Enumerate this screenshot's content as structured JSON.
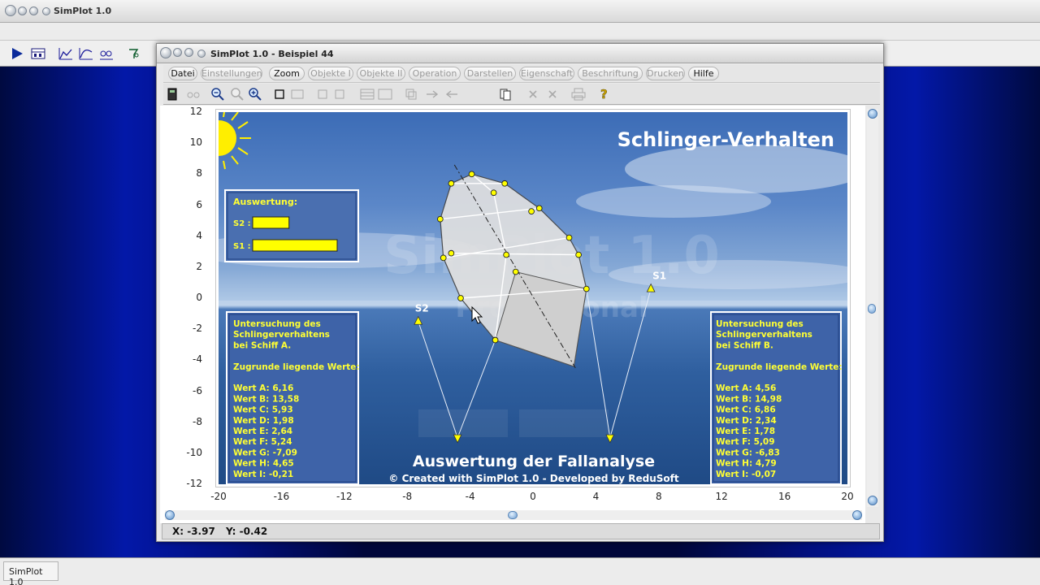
{
  "app": {
    "outer_title": "SimPlot 1.0",
    "status_app": "SimPlot 1.0"
  },
  "window": {
    "title": "SimPlot 1.0 - Beispiel 44"
  },
  "menu": [
    {
      "label": "Datei",
      "active": true
    },
    {
      "label": "Einstellungen",
      "active": false
    },
    {
      "label": "Zoom",
      "active": true
    },
    {
      "label": "Objekte I",
      "active": false
    },
    {
      "label": "Objekte II",
      "active": false
    },
    {
      "label": "Operation",
      "active": false
    },
    {
      "label": "Darstellen",
      "active": false
    },
    {
      "label": "Eigenschaft",
      "active": false
    },
    {
      "label": "Beschriftung",
      "active": false
    },
    {
      "label": "Drucken",
      "active": false
    },
    {
      "label": "Hilfe",
      "active": true
    }
  ],
  "chart_data": {
    "type": "scatter",
    "title": "Schlinger-Verhalten",
    "x_ticks": [
      "-20",
      "-16",
      "-12",
      "-8",
      "-4",
      "0",
      "4",
      "8",
      "12",
      "16",
      "20"
    ],
    "y_ticks": [
      "12",
      "10",
      "8",
      "6",
      "4",
      "2",
      "0",
      "-2",
      "-4",
      "-6",
      "-8",
      "-10",
      "-12"
    ],
    "xlim": [
      -20,
      20
    ],
    "ylim": [
      -12,
      12
    ],
    "ship_outline": [
      [
        -5.2,
        7.4
      ],
      [
        -3.9,
        8.0
      ],
      [
        -1.8,
        7.4
      ],
      [
        0.4,
        5.8
      ],
      [
        2.3,
        3.9
      ],
      [
        2.9,
        2.8
      ],
      [
        3.4,
        0.6
      ],
      [
        2.6,
        -4.4
      ],
      [
        -2.4,
        -2.7
      ],
      [
        -4.6,
        0.0
      ],
      [
        -5.7,
        2.6
      ],
      [
        -5.9,
        5.1
      ]
    ],
    "ship_nodes": [
      [
        -5.2,
        7.4
      ],
      [
        -3.9,
        8.0
      ],
      [
        -1.8,
        7.4
      ],
      [
        -2.5,
        6.8
      ],
      [
        0.4,
        5.8
      ],
      [
        -0.1,
        5.6
      ],
      [
        -5.9,
        5.1
      ],
      [
        2.3,
        3.9
      ],
      [
        -5.7,
        2.6
      ],
      [
        -5.2,
        2.9
      ],
      [
        -1.7,
        2.8
      ],
      [
        2.9,
        2.8
      ],
      [
        -1.1,
        1.7
      ],
      [
        3.4,
        0.6
      ],
      [
        -4.6,
        0.0
      ],
      [
        -2.4,
        -2.7
      ]
    ],
    "center_line": [
      [
        -5.0,
        8.6
      ],
      [
        2.7,
        -4.5
      ]
    ],
    "s1_lines": [
      [
        [
          3.4,
          0.6
        ],
        [
          4.9,
          -9.0
        ]
      ],
      [
        [
          4.9,
          -9.0
        ],
        [
          7.5,
          0.6
        ]
      ]
    ],
    "s2_lines": [
      [
        [
          -7.3,
          -1.5
        ],
        [
          -4.8,
          -9.0
        ]
      ],
      [
        [
          -4.8,
          -9.0
        ],
        [
          -2.4,
          -2.7
        ]
      ]
    ],
    "s1_label": "S1",
    "s2_label": "S2",
    "background_watermark": [
      "SimPlot 1.0",
      "Professional"
    ]
  },
  "panels": {
    "auswertung": {
      "title": "Auswertung:",
      "s2_label": "S2 :",
      "s1_label": "S1 :",
      "s2_value": 0.43,
      "s1_value": 1.0,
      "bar_color": "#ffff00"
    },
    "left": {
      "lines": [
        "Untersuchung des",
        "Schlingerverhaltens",
        "bei Schiff A.",
        "",
        "Zugrunde liegende Werte:",
        "",
        "Wert A: 6,16",
        "Wert B: 13,58",
        "Wert C: 5,93",
        "Wert D: 1,98",
        "Wert E: 2,64",
        "Wert F: 5,24",
        "Wert G: -7,09",
        "Wert H: 4,65",
        "Wert I: -0,21"
      ]
    },
    "right": {
      "lines": [
        "Untersuchung des",
        "Schlingerverhaltens",
        "bei Schiff B.",
        "",
        "Zugrunde liegende Werte:",
        "",
        "Wert A: 4,56",
        "Wert B: 14,98",
        "Wert C: 6,86",
        "Wert D: 2,34",
        "Wert E: 1,78",
        "Wert F: 5,09",
        "Wert G: -6,83",
        "Wert H: 4,79",
        "Wert I: -0,07"
      ]
    },
    "footer_title": "Auswertung der Fallanalyse",
    "footer_credit": "© Created with SimPlot 1.0 - Developed by ReduSoft"
  },
  "coords": {
    "x": "X:  -3.97",
    "y": "Y:  -0.42"
  },
  "colors": {
    "panel_text": "#ffff33",
    "ship_fill": "#e0e0e0",
    "node": "#ffff00"
  }
}
